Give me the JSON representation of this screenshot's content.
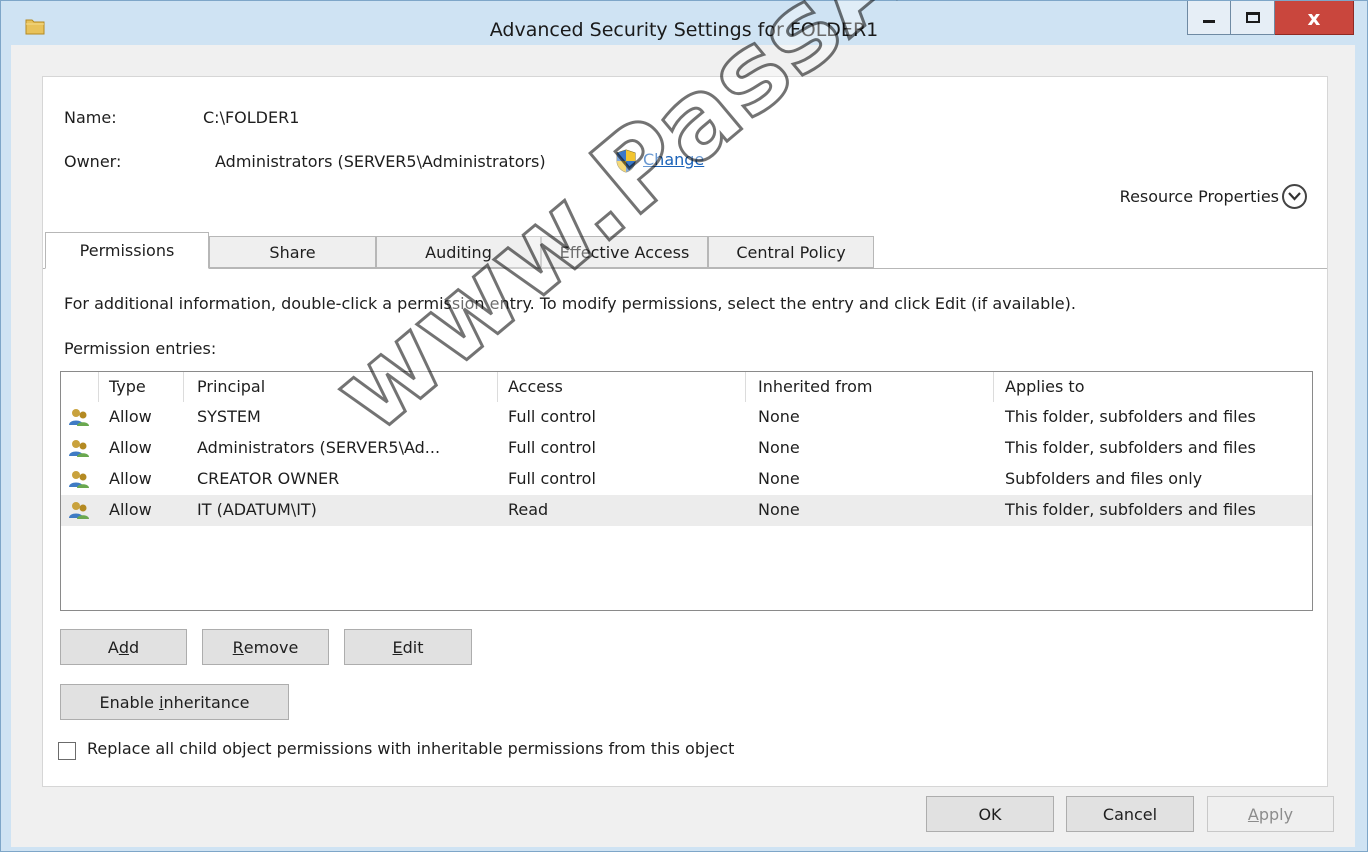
{
  "window": {
    "title": "Advanced Security Settings for FOLDER1",
    "close_glyph": "x"
  },
  "info": {
    "name_label": "Name:",
    "name_value": "C:\\FOLDER1",
    "owner_label": "Owner:",
    "owner_value": "Administrators (SERVER5\\Administrators)",
    "change_link": "Change",
    "resource_properties": "Resource Properties"
  },
  "tabs": [
    {
      "label": "Permissions",
      "active": true
    },
    {
      "label": "Share",
      "active": false
    },
    {
      "label": "Auditing",
      "active": false
    },
    {
      "label": "Effective Access",
      "active": false
    },
    {
      "label": "Central Policy",
      "active": false
    }
  ],
  "instructions": "For additional information, double-click a permission entry. To modify permissions, select the entry and click Edit (if available).",
  "entries_label": "Permission entries:",
  "grid": {
    "columns": [
      "Type",
      "Principal",
      "Access",
      "Inherited from",
      "Applies to"
    ],
    "rows": [
      {
        "type": "Allow",
        "principal": "SYSTEM",
        "access": "Full control",
        "inherited": "None",
        "applies": "This folder, subfolders and files",
        "selected": false
      },
      {
        "type": "Allow",
        "principal": "Administrators (SERVER5\\Ad...",
        "access": "Full control",
        "inherited": "None",
        "applies": "This folder, subfolders and files",
        "selected": false
      },
      {
        "type": "Allow",
        "principal": "CREATOR OWNER",
        "access": "Full control",
        "inherited": "None",
        "applies": "Subfolders and files only",
        "selected": false
      },
      {
        "type": "Allow",
        "principal": "IT (ADATUM\\IT)",
        "access": "Read",
        "inherited": "None",
        "applies": "This folder, subfolders and files",
        "selected": true
      }
    ]
  },
  "buttons": {
    "add": {
      "pre": "A",
      "key": "d",
      "post": "d"
    },
    "remove": {
      "pre": "",
      "key": "R",
      "post": "emove"
    },
    "edit": {
      "pre": "",
      "key": "E",
      "post": "dit"
    },
    "enable_inheritance": {
      "pre": "Enable ",
      "key": "i",
      "post": "nheritance"
    },
    "ok": "OK",
    "cancel": "Cancel",
    "apply": {
      "pre": "",
      "key": "A",
      "post": "pply"
    }
  },
  "replace_checkbox": {
    "label": "Replace all child object permissions with inheritable permissions from this object",
    "checked": false
  },
  "watermark": "www.PassApply.com",
  "colors": {
    "titlebar": "#cfe3f3",
    "close_button": "#c9463d",
    "link": "#1a62b8",
    "selected_row": "#ececec"
  },
  "icons": [
    "folder-icon",
    "shield-icon",
    "users-icon",
    "chevron-down-icon"
  ]
}
